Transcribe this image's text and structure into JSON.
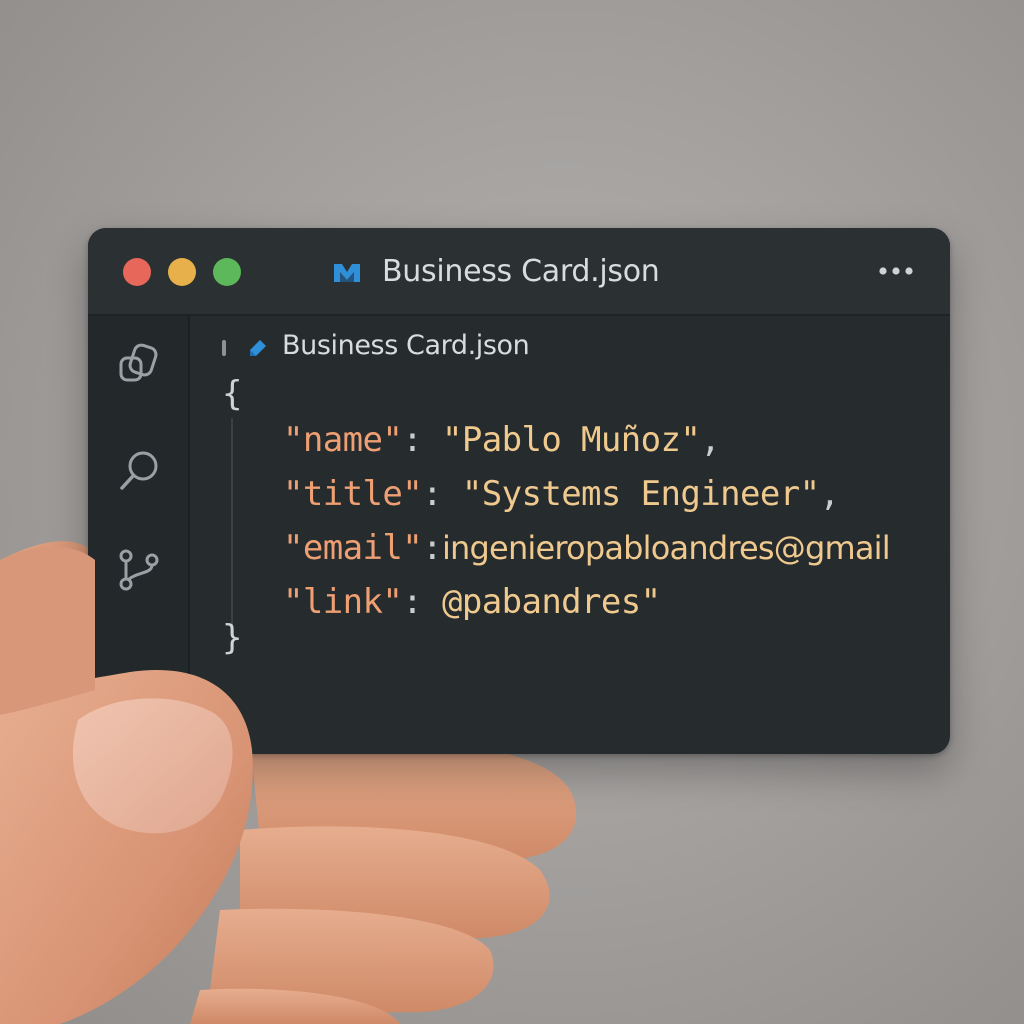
{
  "window": {
    "title": "Business Card.json",
    "tab_label": "Business Card.json",
    "traffic_lights": [
      "#e7685a",
      "#e8b04a",
      "#5cb85a"
    ]
  },
  "icons": {
    "title_icon": "vscode-logo-icon",
    "tab_icon": "json-file-icon",
    "more": "more-horizontal-icon",
    "sidebar": [
      "files-icon",
      "search-icon",
      "source-control-icon"
    ]
  },
  "code": {
    "open_brace": "{",
    "close_brace": "}",
    "lines": [
      {
        "key": "\"name\"",
        "colon": ":",
        "value": "\"Pablo Muñoz\"",
        "trail": ","
      },
      {
        "key": "\"title\"",
        "colon": ":",
        "value": "\"Systems Engineer\"",
        "trail": ","
      },
      {
        "key": "\"email\"",
        "colon": ":",
        "value": "ingenieropabloandres@gmail",
        "trail": ""
      },
      {
        "key": "\"link\"",
        "colon": ":",
        "value": "@pabandres\"",
        "trail": ""
      }
    ]
  },
  "colors": {
    "card_bg": "#262b2e",
    "key": "#ee9f73",
    "value": "#efc98e",
    "text": "#d9dcdd"
  }
}
